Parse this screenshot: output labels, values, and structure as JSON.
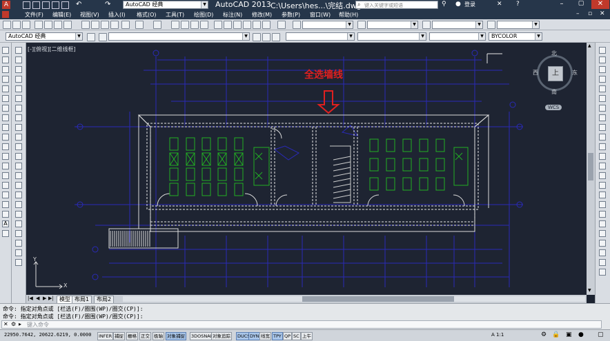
{
  "titlebar": {
    "workspace": "AutoCAD 经典",
    "app_title": "AutoCAD 2013",
    "file_path": "C:\\Users\\hes...\\完结.dwg",
    "search_placeholder": "键入关键字或短语",
    "login": "登录"
  },
  "menu": [
    "文件(F)",
    "编辑(E)",
    "视图(V)",
    "插入(I)",
    "格式(O)",
    "工具(T)",
    "绘图(D)",
    "标注(N)",
    "修改(M)",
    "参数(P)",
    "窗口(W)",
    "帮助(H)"
  ],
  "toolbar2": {
    "workspace_combo": "AutoCAD 经典",
    "bylayer": "BYCOLOR"
  },
  "viewport": {
    "label": "[-][俯视][二维线框]",
    "annotation": "全选墙线",
    "annotation_color": "#e02020",
    "viewcube_top": "上",
    "viewcube_north": "北",
    "viewcube_south": "南",
    "viewcube_east": "东",
    "viewcube_west": "西",
    "wcs": "WCS",
    "ucs_x": "X",
    "ucs_y": "Y"
  },
  "layout_tabs": [
    "模型",
    "布局1",
    "布局2"
  ],
  "command": {
    "line1": "命令: 指定对角点或 [栏选(F)/圈围(WP)/圈交(CP)]:",
    "line2": "命令: 指定对角点或 [栏选(F)/圈围(WP)/圈交(CP)]:",
    "placeholder": "键入命令"
  },
  "status": {
    "coords": "22950.7642, 20622.6219, 0.0000",
    "toggles": [
      "INFER",
      "捕捉",
      "栅格",
      "正交",
      "极轴",
      "对象捕捉",
      "3DOSNAP",
      "对象追踪",
      "DUCS",
      "DYN",
      "线宽",
      "TPY",
      "QP",
      "SC",
      "上午"
    ],
    "active_toggles": [
      "对象捕捉",
      "DUCS",
      "DYN",
      "TPY"
    ],
    "scale": "A 1:1"
  },
  "colors": {
    "drawing_bg": "#1e2432",
    "wall": "#dcdcdc",
    "blue_lines": "#2a2ab8",
    "green_furniture": "#22b022"
  }
}
